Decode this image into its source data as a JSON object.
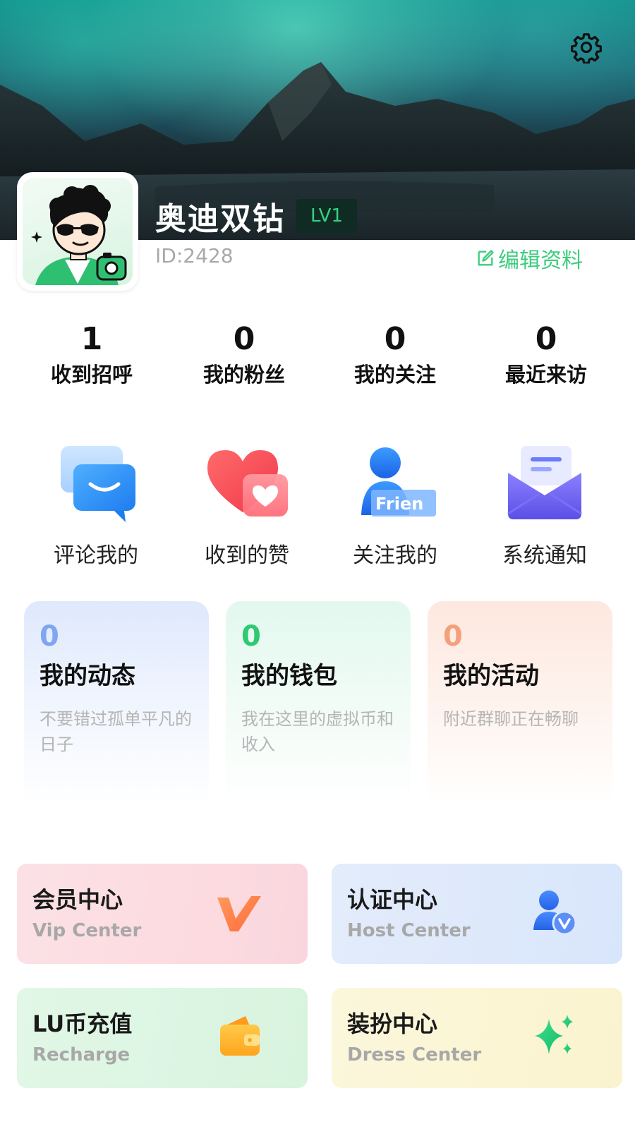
{
  "header": {
    "settings_icon": "gear-icon"
  },
  "profile": {
    "username": "奥迪双钻",
    "level": "LV1",
    "user_id": "ID:2428",
    "edit_label": "编辑资料",
    "edit_icon": "edit-icon",
    "accent_color": "#3dcc7e"
  },
  "stats": [
    {
      "value": "1",
      "label": "收到招呼"
    },
    {
      "value": "0",
      "label": "我的粉丝"
    },
    {
      "value": "0",
      "label": "我的关注"
    },
    {
      "value": "0",
      "label": "最近来访"
    }
  ],
  "quick_actions": [
    {
      "label": "评论我的",
      "icon": "chat-bubble-icon"
    },
    {
      "label": "收到的赞",
      "icon": "heart-icon"
    },
    {
      "label": "关注我的",
      "icon": "friend-user-icon",
      "icon_text": "Frien"
    },
    {
      "label": "系统通知",
      "icon": "mail-envelope-icon"
    }
  ],
  "cards": [
    {
      "count": "0",
      "title": "我的动态",
      "desc": "不要错过孤单平凡的日子",
      "color": "#7ea6f3"
    },
    {
      "count": "0",
      "title": "我的钱包",
      "desc": "我在这里的虚拟币和收入",
      "color": "#2ec970"
    },
    {
      "count": "0",
      "title": "我的活动",
      "desc": "附近群聊正在畅聊",
      "color": "#f5a07c"
    }
  ],
  "services": [
    {
      "title": "会员中心",
      "subtitle": "Vip Center",
      "icon": "vip-v-icon"
    },
    {
      "title": "认证中心",
      "subtitle": "Host Center",
      "icon": "verified-user-icon"
    },
    {
      "title": "LU币充值",
      "subtitle": "Recharge",
      "icon": "wallet-icon"
    },
    {
      "title": "装扮中心",
      "subtitle": "Dress Center",
      "icon": "sparkle-icon"
    }
  ]
}
